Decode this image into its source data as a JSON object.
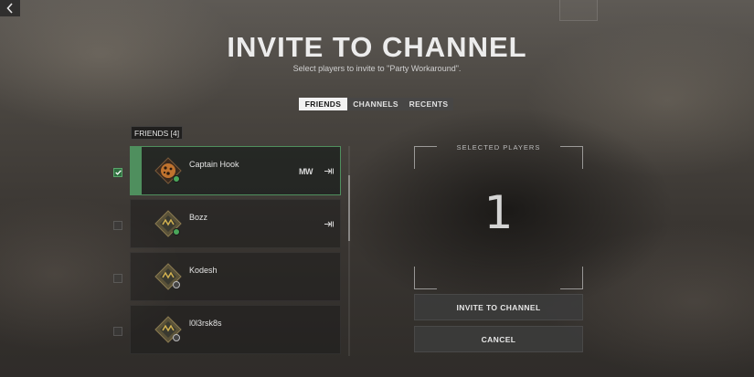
{
  "header": {
    "title": "INVITE TO CHANNEL",
    "subtitle": "Select players to invite to \"Party Workaround\"."
  },
  "tabs": [
    {
      "label": "FRIENDS",
      "active": true
    },
    {
      "label": "CHANNELS",
      "active": false
    },
    {
      "label": "RECENTS",
      "active": false
    }
  ],
  "friends": {
    "label": "FRIENDS [4]",
    "items": [
      {
        "name": "Captain Hook",
        "selected": true,
        "status": "online",
        "game": "MW",
        "joinable": true
      },
      {
        "name": "Bozz",
        "selected": false,
        "status": "online",
        "game": "",
        "joinable": true
      },
      {
        "name": "Kodesh",
        "selected": false,
        "status": "offline",
        "game": "",
        "joinable": false
      },
      {
        "name": "l0l3rsk8s",
        "selected": false,
        "status": "offline",
        "game": "",
        "joinable": false
      }
    ]
  },
  "selected_players": {
    "label": "SELECTED PLAYERS",
    "count": "1"
  },
  "actions": {
    "invite_label": "INVITE TO CHANNEL",
    "cancel_label": "CANCEL"
  },
  "colors": {
    "accent": "#4f8f5e",
    "online": "#4aa65a"
  }
}
